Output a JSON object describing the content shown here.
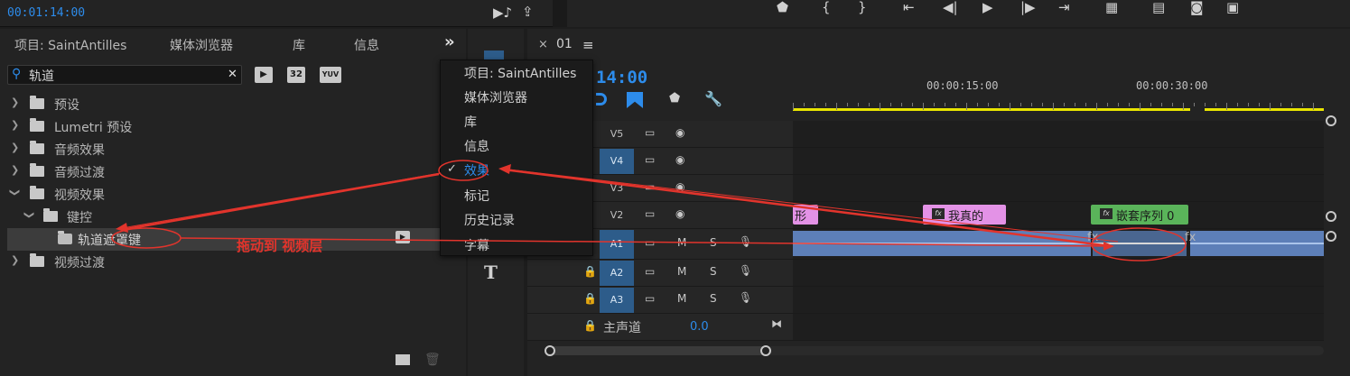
{
  "header": {
    "timecode": "00:01:14:00"
  },
  "effects_panel": {
    "tabs": [
      "项目: SaintAntilles",
      "媒体浏览器",
      "库",
      "信息"
    ],
    "overflow_label": "»",
    "search": {
      "value": "轨道",
      "clear_label": "✕"
    },
    "filter_icons": [
      "32",
      "YUV"
    ],
    "tree": [
      {
        "label": "预设",
        "expanded": false
      },
      {
        "label": "Lumetri 预设",
        "expanded": false
      },
      {
        "label": "音频效果",
        "expanded": false
      },
      {
        "label": "音频过渡",
        "expanded": false
      },
      {
        "label": "视频效果",
        "expanded": true
      },
      {
        "label": "键控",
        "expanded": true
      },
      {
        "label": "轨道遮罩键",
        "selected": true
      },
      {
        "label": "视频过渡",
        "expanded": false
      }
    ]
  },
  "context_menu": {
    "items": [
      {
        "label": "项目: SaintAntilles"
      },
      {
        "label": "媒体浏览器"
      },
      {
        "label": "库"
      },
      {
        "label": "信息"
      },
      {
        "label": "效果",
        "checked": true
      },
      {
        "label": "标记"
      },
      {
        "label": "历史记录"
      },
      {
        "label": "字幕"
      }
    ],
    "check_mark": "✓"
  },
  "timeline": {
    "tab_close": "×",
    "tab_label": "01",
    "tab_menu": "≡",
    "sequence_timecode": "14:00",
    "ruler_labels": [
      "00:00:15:00",
      "00:00:30:00"
    ],
    "tracks": [
      {
        "name": "V5",
        "targeted": false
      },
      {
        "name": "V4",
        "targeted": true
      },
      {
        "name": "V3",
        "targeted": false
      },
      {
        "name": "V2",
        "targeted": false
      },
      {
        "name": "A1",
        "targeted": true,
        "m": "M",
        "s": "S"
      },
      {
        "name": "A2",
        "targeted": true,
        "m": "M",
        "s": "S"
      },
      {
        "name": "A3",
        "targeted": true,
        "m": "M",
        "s": "S"
      }
    ],
    "master": {
      "label": "主声道",
      "value": "0.0"
    },
    "clips": [
      {
        "label": "形",
        "color": "#e392e6"
      },
      {
        "label": "我真的",
        "color": "#e392e6"
      },
      {
        "label": "嵌套序列 0",
        "color": "#5ab45a"
      }
    ],
    "fx_label": "fx"
  },
  "annotations": {
    "drag_text": "拖动到 视频层",
    "color": "#e2342c"
  },
  "colors": {
    "accent": "#2d8ceb",
    "work_area": "#e8e400",
    "target_track": "#2d5c8a",
    "audio_clip": "#5d7fb8"
  }
}
